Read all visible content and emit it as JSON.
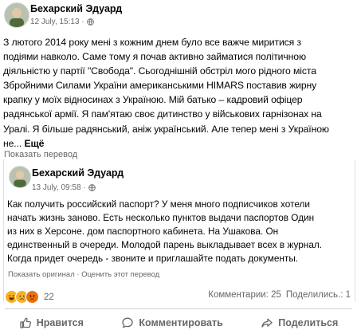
{
  "post": {
    "author": "Бехарский Эдуард",
    "date": "12 July, 15:13 ·",
    "text_lines": [
      "З лютого 2014 року мені з кожним днем було все важче миритися з",
      "подіями навколо.  Саме тому я почав активно займатися політичною",
      "діяльністю у партії \"Свобода\".  Сьогоднішній обстріл мого рідного міста",
      "Збройними Силами України американськими HIMARS поставив жирну",
      "крапку у моїх відносинах з Україною.   Мій батько – кадровий офіцер",
      "радянської армії.  Я пам'ятаю своє дитинство у військових гарнізонах на",
      "Уралі.  Я більше радянський, аніж український.  Але тепер мені з Україною",
      "не..."
    ],
    "more_label": "Ещё",
    "translate_label": "Показать перевод"
  },
  "shared": {
    "author": "Бехарский Эдуард",
    "date": "13 July, 09:58 ·",
    "text_lines": [
      "Как получить российский паспорт? У меня много подписчиков хотели",
      "начать жизнь заново. Есть несколько пунктов выдачи паспортов Один",
      "из них в Херсоне. дом паспортного кабинета. На Ушакова. Он",
      "единственный в очереди. Молодой парень выкладывает всех в журнал.",
      "Когда придет очередь - звоните и приглашайте подать документы."
    ],
    "show_original": "Показать оригинал",
    "rate_translation": "Оценить этот перевод",
    "separator": "·"
  },
  "footer": {
    "reaction_count": "22",
    "comments": "Комментарии: 25",
    "shares": "Поделились.: 1",
    "like_label": "Нравится",
    "comment_label": "Комментировать",
    "share_label": "Поделиться"
  }
}
